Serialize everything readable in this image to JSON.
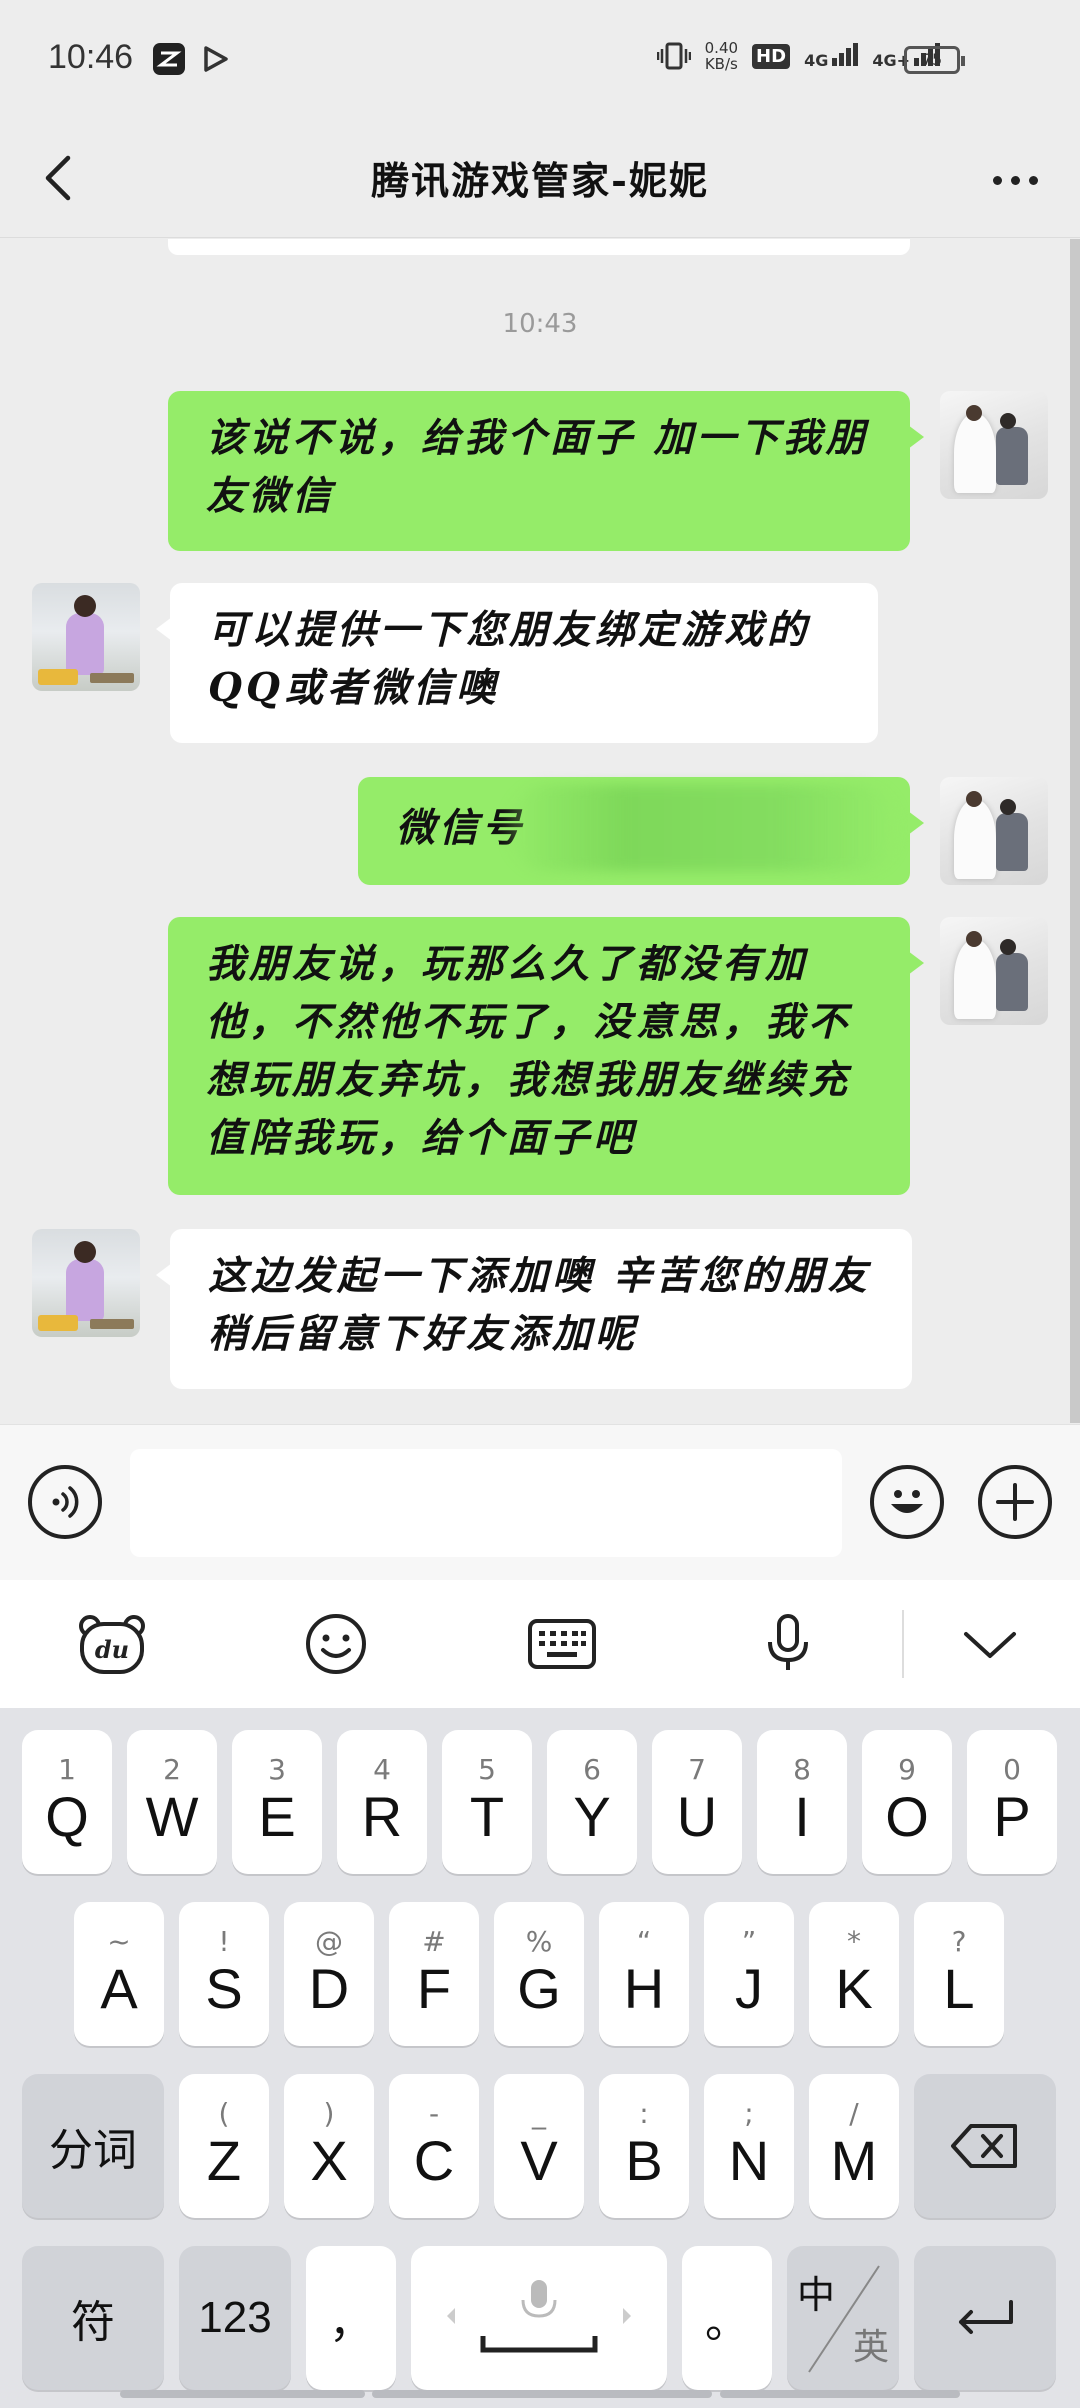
{
  "status": {
    "time": "10:46",
    "net_speed_value": "0.40",
    "net_speed_unit": "KB/s",
    "hd": "HD",
    "sim1": "4G",
    "sim2": "4G+",
    "battery": "75"
  },
  "nav": {
    "title": "腾讯游戏管家-妮妮"
  },
  "chat": {
    "timestamp": "10:43",
    "messages": [
      {
        "side": "me",
        "text": "该说不说，给我个面子 加一下我朋友微信"
      },
      {
        "side": "them",
        "text": "可以提供一下您朋友绑定游戏的QQ或者微信噢"
      },
      {
        "side": "me",
        "text": "微信号"
      },
      {
        "side": "me",
        "text": "我朋友说，玩那么久了都没有加他，不然他不玩了，没意思，我不想玩朋友弃坑，我想我朋友继续充值陪我玩，给个面子吧"
      },
      {
        "side": "them",
        "text": "这边发起一下添加噢 辛苦您的朋友稍后留意下好友添加呢"
      }
    ]
  },
  "keyboard": {
    "row1": [
      {
        "hint": "1",
        "key": "Q"
      },
      {
        "hint": "2",
        "key": "W"
      },
      {
        "hint": "3",
        "key": "E"
      },
      {
        "hint": "4",
        "key": "R"
      },
      {
        "hint": "5",
        "key": "T"
      },
      {
        "hint": "6",
        "key": "Y"
      },
      {
        "hint": "7",
        "key": "U"
      },
      {
        "hint": "8",
        "key": "I"
      },
      {
        "hint": "9",
        "key": "O"
      },
      {
        "hint": "0",
        "key": "P"
      }
    ],
    "row2": [
      {
        "hint": "~",
        "key": "A"
      },
      {
        "hint": "!",
        "key": "S"
      },
      {
        "hint": "@",
        "key": "D"
      },
      {
        "hint": "#",
        "key": "F"
      },
      {
        "hint": "%",
        "key": "G"
      },
      {
        "hint": "“",
        "key": "H"
      },
      {
        "hint": "”",
        "key": "J"
      },
      {
        "hint": "*",
        "key": "K"
      },
      {
        "hint": "?",
        "key": "L"
      }
    ],
    "row3": [
      {
        "hint": "(",
        "key": "Z"
      },
      {
        "hint": ")",
        "key": "X"
      },
      {
        "hint": "-",
        "key": "C"
      },
      {
        "hint": "_",
        "key": "V"
      },
      {
        "hint": ":",
        "key": "B"
      },
      {
        "hint": ";",
        "key": "N"
      },
      {
        "hint": "/",
        "key": "M"
      }
    ],
    "segment_label": "分词",
    "symbols_label": "符",
    "numbers_label": "123",
    "comma_label": "，",
    "period_label": "。",
    "lang_zh": "中",
    "lang_en": "英"
  }
}
